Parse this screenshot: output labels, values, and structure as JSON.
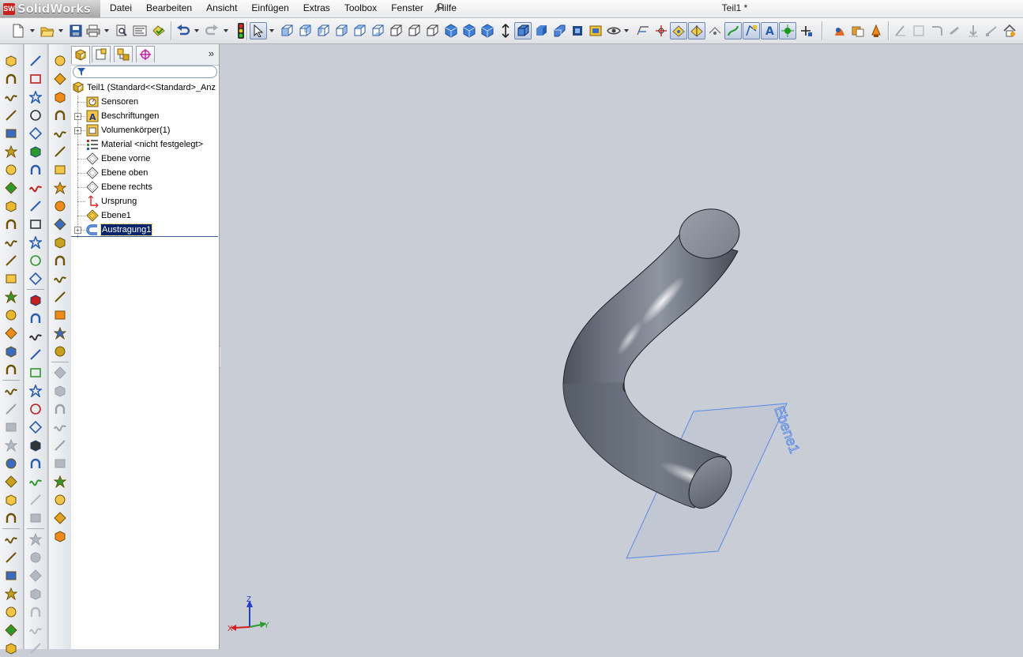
{
  "app": {
    "logo_text": "SolidWorks",
    "logo_badge": "SW",
    "document_title": "Teil1 *"
  },
  "menu": {
    "items": [
      "Datei",
      "Bearbeiten",
      "Ansicht",
      "Einfügen",
      "Extras",
      "Toolbox",
      "Fenster",
      "Hilfe"
    ]
  },
  "feature_tree": {
    "root": "Teil1  (Standard<<Standard>_Anz",
    "items": [
      {
        "label": "Sensoren",
        "icon": "sensor-icon",
        "expandable": false
      },
      {
        "label": "Beschriftungen",
        "icon": "annotations-icon",
        "expandable": true
      },
      {
        "label": "Volumenkörper(1)",
        "icon": "solid-bodies-icon",
        "expandable": true
      },
      {
        "label": "Material <nicht festgelegt>",
        "icon": "material-icon",
        "expandable": false
      },
      {
        "label": "Ebene vorne",
        "icon": "plane-icon",
        "expandable": false
      },
      {
        "label": "Ebene oben",
        "icon": "plane-icon",
        "expandable": false
      },
      {
        "label": "Ebene rechts",
        "icon": "plane-icon",
        "expandable": false
      },
      {
        "label": "Ursprung",
        "icon": "origin-icon",
        "expandable": false
      },
      {
        "label": "Ebene1",
        "icon": "plane-icon",
        "expandable": false
      },
      {
        "label": "Austragung1",
        "icon": "sweep-icon",
        "expandable": true,
        "selected": true
      }
    ]
  },
  "viewport": {
    "plane_label": "Ebene1",
    "triad": {
      "x": "X",
      "y": "Y",
      "z": "Z"
    }
  },
  "colors": {
    "background": "#c9cdd6",
    "plane_edge": "#5b8ae6",
    "selection": "#0a246a",
    "body": "#7b8291"
  }
}
